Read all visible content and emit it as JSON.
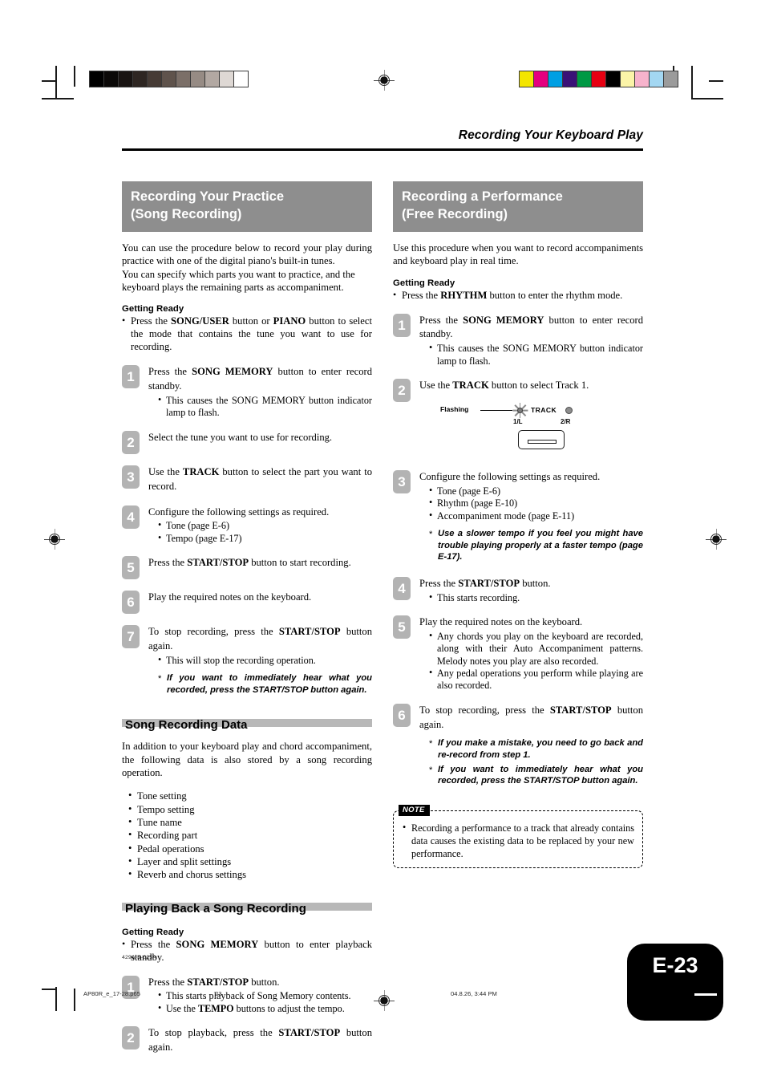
{
  "running_head": "Recording Your Keyboard Play",
  "left_column": {
    "banner": {
      "line1": "Recording Your Practice",
      "line2": "(Song Recording)"
    },
    "intro_a": "You can use the procedure below to record your play during practice with one of the digital piano's built-in tunes.",
    "intro_b": "You can specify which parts you want to practice, and the keyboard plays the remaining parts as accompaniment.",
    "getting_ready_label": "Getting Ready",
    "getting_ready_items": [
      "Press the SONG/USER button or PIANO button to select the mode that contains the tune you want to use for recording."
    ],
    "steps": [
      {
        "num": "1",
        "lead": "Press the SONG MEMORY button to enter record standby.",
        "subs": [
          "This causes the SONG MEMORY button indicator lamp to flash."
        ],
        "stars": []
      },
      {
        "num": "2",
        "lead": "Select the tune you want to use for recording.",
        "subs": [],
        "stars": []
      },
      {
        "num": "3",
        "lead": "Use the TRACK button to select the part you want to record.",
        "subs": [],
        "stars": []
      },
      {
        "num": "4",
        "lead": "Configure the following settings as required.",
        "subs": [
          "Tone (page E-6)",
          "Tempo (page E-17)"
        ],
        "stars": []
      },
      {
        "num": "5",
        "lead": "Press the START/STOP button to start recording.",
        "subs": [],
        "stars": []
      },
      {
        "num": "6",
        "lead": "Play the required notes on the keyboard.",
        "subs": [],
        "stars": []
      },
      {
        "num": "7",
        "lead": "To stop recording, press the START/STOP button again.",
        "subs": [
          "This will stop the recording operation."
        ],
        "stars": [
          "If you want to immediately hear what you recorded, press the START/STOP button again."
        ]
      }
    ],
    "subsection_1": {
      "heading": "Song Recording Data",
      "intro": "In addition to your keyboard play and chord accompaniment, the following data is also stored by a song recording operation.",
      "bullets": [
        "Tone setting",
        "Tempo setting",
        "Tune name",
        "Recording part",
        "Pedal operations",
        "Layer and split settings",
        "Reverb and chorus settings"
      ]
    },
    "subsection_2": {
      "heading": "Playing Back a Song Recording",
      "getting_ready_label": "Getting Ready",
      "getting_ready_items": [
        "Press the SONG MEMORY button to enter playback standby."
      ],
      "steps": [
        {
          "num": "1",
          "lead": "Press the START/STOP button.",
          "subs": [
            "This starts playback of Song Memory contents.",
            "Use the TEMPO buttons to adjust the tempo."
          ],
          "stars": []
        },
        {
          "num": "2",
          "lead": "To stop playback, press the START/STOP button again.",
          "subs": [],
          "stars": []
        }
      ]
    }
  },
  "right_column": {
    "banner": {
      "line1": "Recording a Performance",
      "line2": "(Free Recording)"
    },
    "intro_a": "Use this procedure when you want to record accompaniments and keyboard play in real time.",
    "getting_ready_label": "Getting Ready",
    "getting_ready_items": [
      "Press the RHYTHM button to enter the rhythm mode."
    ],
    "steps": [
      {
        "num": "1",
        "lead": "Press the SONG MEMORY button to enter record standby.",
        "subs": [
          "This causes the SONG MEMORY button indicator lamp to flash."
        ],
        "stars": []
      },
      {
        "num": "2",
        "lead": "Use the TRACK button to select Track 1.",
        "subs": [],
        "stars": []
      },
      {
        "num": "3",
        "lead": "Configure the following settings as required.",
        "subs": [
          "Tone (page E-6)",
          "Rhythm (page E-10)",
          "Accompaniment mode (page E-11)"
        ],
        "stars": [
          "Use a slower tempo if you feel you might have trouble playing properly at a faster tempo (page E-17)."
        ]
      },
      {
        "num": "4",
        "lead": "Press the START/STOP button.",
        "subs": [
          "This starts recording."
        ],
        "stars": []
      },
      {
        "num": "5",
        "lead": "Play the required notes on the keyboard.",
        "subs": [
          "Any chords you play on the keyboard are recorded, along with their Auto Accompaniment patterns.  Melody notes you play are also recorded.",
          "Any pedal operations you perform while playing are also recorded."
        ],
        "stars": []
      },
      {
        "num": "6",
        "lead": "To stop recording, press the START/STOP button again.",
        "subs": [],
        "stars": [
          "If you make a mistake, you need to go back and re-record from step 1.",
          "If you want to immediately hear what you recorded, press the START/STOP button again."
        ]
      }
    ],
    "track_figure": {
      "flashing_label": "Flashing",
      "track_label": "TRACK",
      "lamp1_label": "1/L",
      "lamp2_label": "2/R"
    },
    "note": {
      "tag": "NOTE",
      "items": [
        "Recording a performance to a track that already contains data causes the existing data to be replaced by your new performance."
      ]
    }
  },
  "footer": {
    "code": "429A-E-025A",
    "filename": "AP80R_e_17-28.p65",
    "page_number": "23",
    "timestamp": "04.8.26, 3:44 PM",
    "page_badge": "E-23"
  },
  "print_marks": {
    "gray_wedge": [
      "#000000",
      "#0b0908",
      "#191412",
      "#2e2622",
      "#463b35",
      "#5f534c",
      "#7b6f68",
      "#968b84",
      "#b2a8a2",
      "#ded8d4",
      "#ffffff"
    ],
    "color_bar": [
      "#f3e500",
      "#e4007f",
      "#009fe3",
      "#3a1177",
      "#009944",
      "#e60012",
      "#000000",
      "#fbf4a8",
      "#f7b3cc",
      "#a3d7f2",
      "#9b9b9b"
    ]
  }
}
